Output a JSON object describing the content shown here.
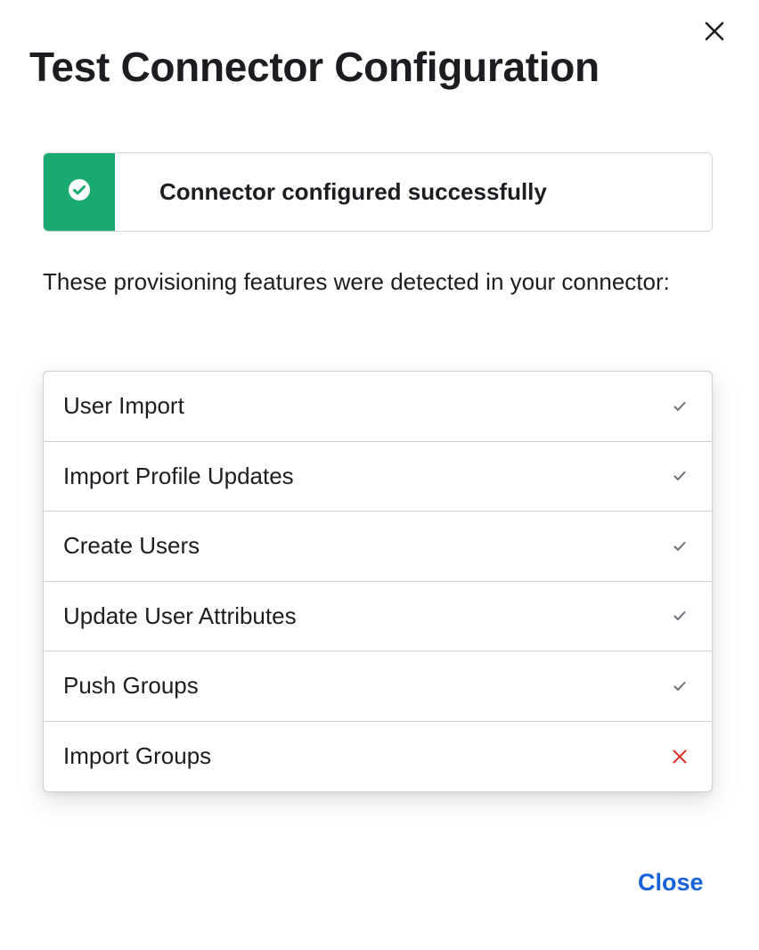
{
  "dialog": {
    "title": "Test Connector Configuration",
    "close_icon": "close-icon",
    "close_button_label": "Close"
  },
  "banner": {
    "icon": "check-circle-icon",
    "message": "Connector configured successfully",
    "accent_color": "#1aaa6f"
  },
  "description": "These provisioning features were detected in your connector:",
  "features": [
    {
      "label": "User Import",
      "status": "supported",
      "icon": "check-icon"
    },
    {
      "label": "Import Profile Updates",
      "status": "supported",
      "icon": "check-icon"
    },
    {
      "label": "Create Users",
      "status": "supported",
      "icon": "check-icon"
    },
    {
      "label": "Update User Attributes",
      "status": "supported",
      "icon": "check-icon"
    },
    {
      "label": "Push Groups",
      "status": "supported",
      "icon": "check-icon"
    },
    {
      "label": "Import Groups",
      "status": "unsupported",
      "icon": "x-icon"
    }
  ],
  "colors": {
    "success": "#1aaa6f",
    "error": "#d92d20",
    "link": "#1662dd",
    "check": "#6e6e78"
  }
}
